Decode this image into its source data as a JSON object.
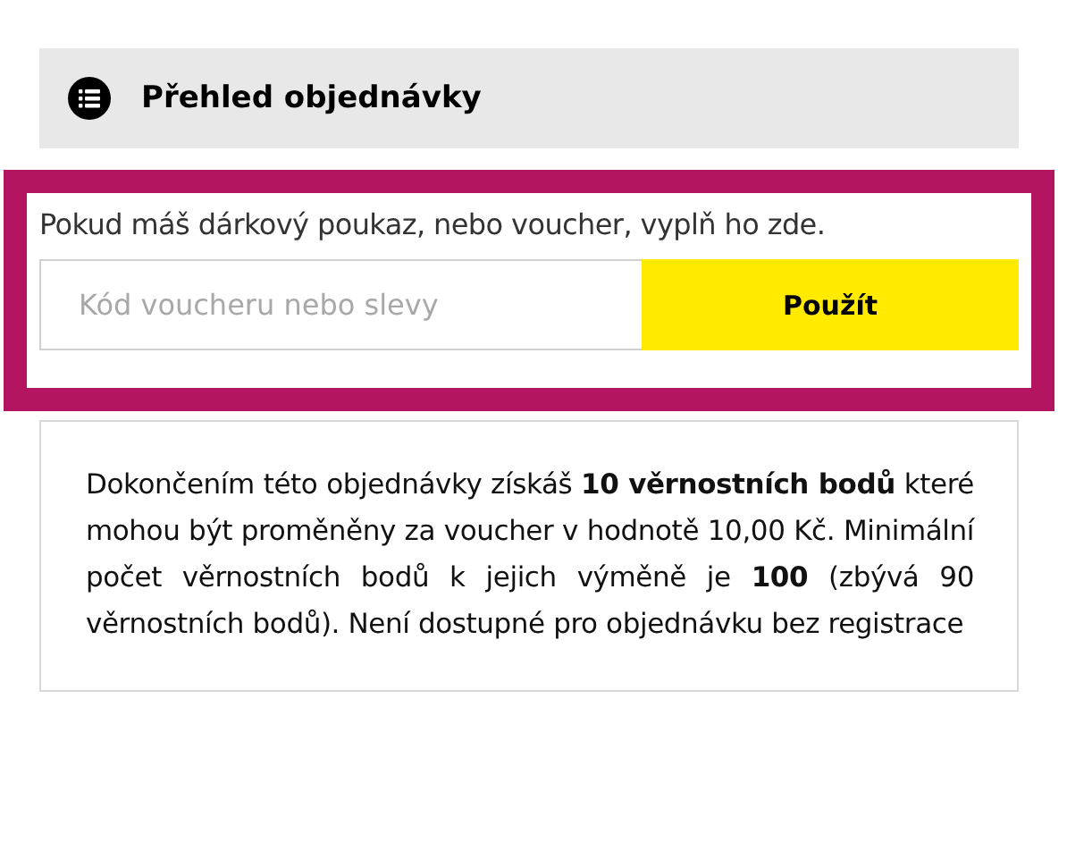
{
  "summary_header": {
    "title": "Přehled objednávky"
  },
  "voucher": {
    "prompt": "Pokud máš dárkový poukaz, nebo voucher, vyplň ho zde.",
    "placeholder": "Kód voucheru nebo slevy",
    "button": "Použít",
    "highlighted": true
  },
  "loyalty_note": "Dokončením této objednávky získáš **10 věrnostních bodů** které mohou být proměněny za voucher v hodnotě 10,00 Kč. Minimální počet věrnostních bodů k jejich výměně je **100** (zbývá 90 věrnostních bodů). Není dostupné pro objednávku bez registrace"
}
